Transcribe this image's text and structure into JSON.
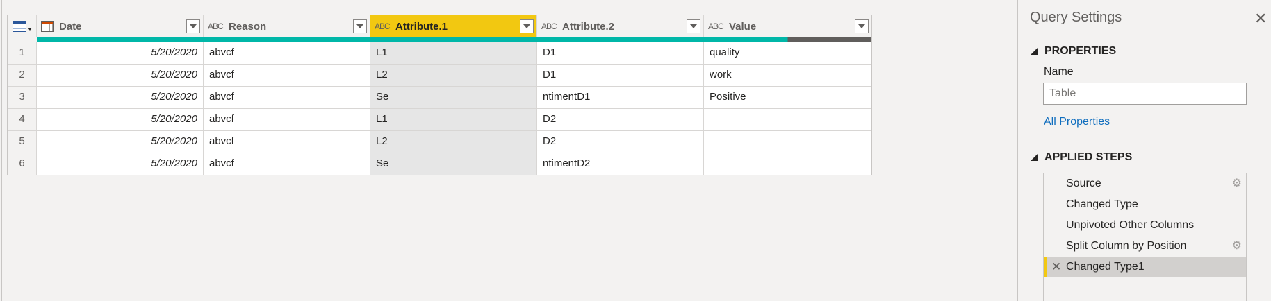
{
  "grid": {
    "columns": [
      {
        "name": "Date",
        "type_icon": "calendar-icon"
      },
      {
        "name": "Reason",
        "type_icon": "abc-icon"
      },
      {
        "name": "Attribute.1",
        "type_icon": "abc-icon"
      },
      {
        "name": "Attribute.2",
        "type_icon": "abc-icon"
      },
      {
        "name": "Value",
        "type_icon": "abc-icon"
      }
    ],
    "type_icon_text": "ABC",
    "rows": [
      {
        "idx": "1",
        "date": "5/20/2020",
        "reason": "abvcf",
        "a1": "L1",
        "a2": "D1",
        "value": "quality"
      },
      {
        "idx": "2",
        "date": "5/20/2020",
        "reason": "abvcf",
        "a1": "L2",
        "a2": "D1",
        "value": "work"
      },
      {
        "idx": "3",
        "date": "5/20/2020",
        "reason": "abvcf",
        "a1": "Se",
        "a2": "ntimentD1",
        "value": "Positive"
      },
      {
        "idx": "4",
        "date": "5/20/2020",
        "reason": "abvcf",
        "a1": "L1",
        "a2": "D2",
        "value": ""
      },
      {
        "idx": "5",
        "date": "5/20/2020",
        "reason": "abvcf",
        "a1": "L2",
        "a2": "D2",
        "value": ""
      },
      {
        "idx": "6",
        "date": "5/20/2020",
        "reason": "abvcf",
        "a1": "Se",
        "a2": "ntimentD2",
        "value": ""
      }
    ],
    "selected_column": "Attribute.1",
    "colors": {
      "selected_header": "#f2c811",
      "quality_valid": "#00b7a8",
      "quality_empty": "#605e5c"
    },
    "value_quality_valid_fraction": 0.5
  },
  "query_settings": {
    "title": "Query Settings",
    "close_icon": "close-icon",
    "properties_header": "PROPERTIES",
    "name_label": "Name",
    "name_value": "Table",
    "all_properties_link": "All Properties",
    "applied_steps_header": "APPLIED STEPS",
    "steps": [
      {
        "label": "Source",
        "has_gear": true
      },
      {
        "label": "Changed Type",
        "has_gear": false
      },
      {
        "label": "Unpivoted Other Columns",
        "has_gear": false
      },
      {
        "label": "Split Column by Position",
        "has_gear": true
      },
      {
        "label": "Changed Type1",
        "has_gear": false,
        "active": true
      }
    ]
  }
}
